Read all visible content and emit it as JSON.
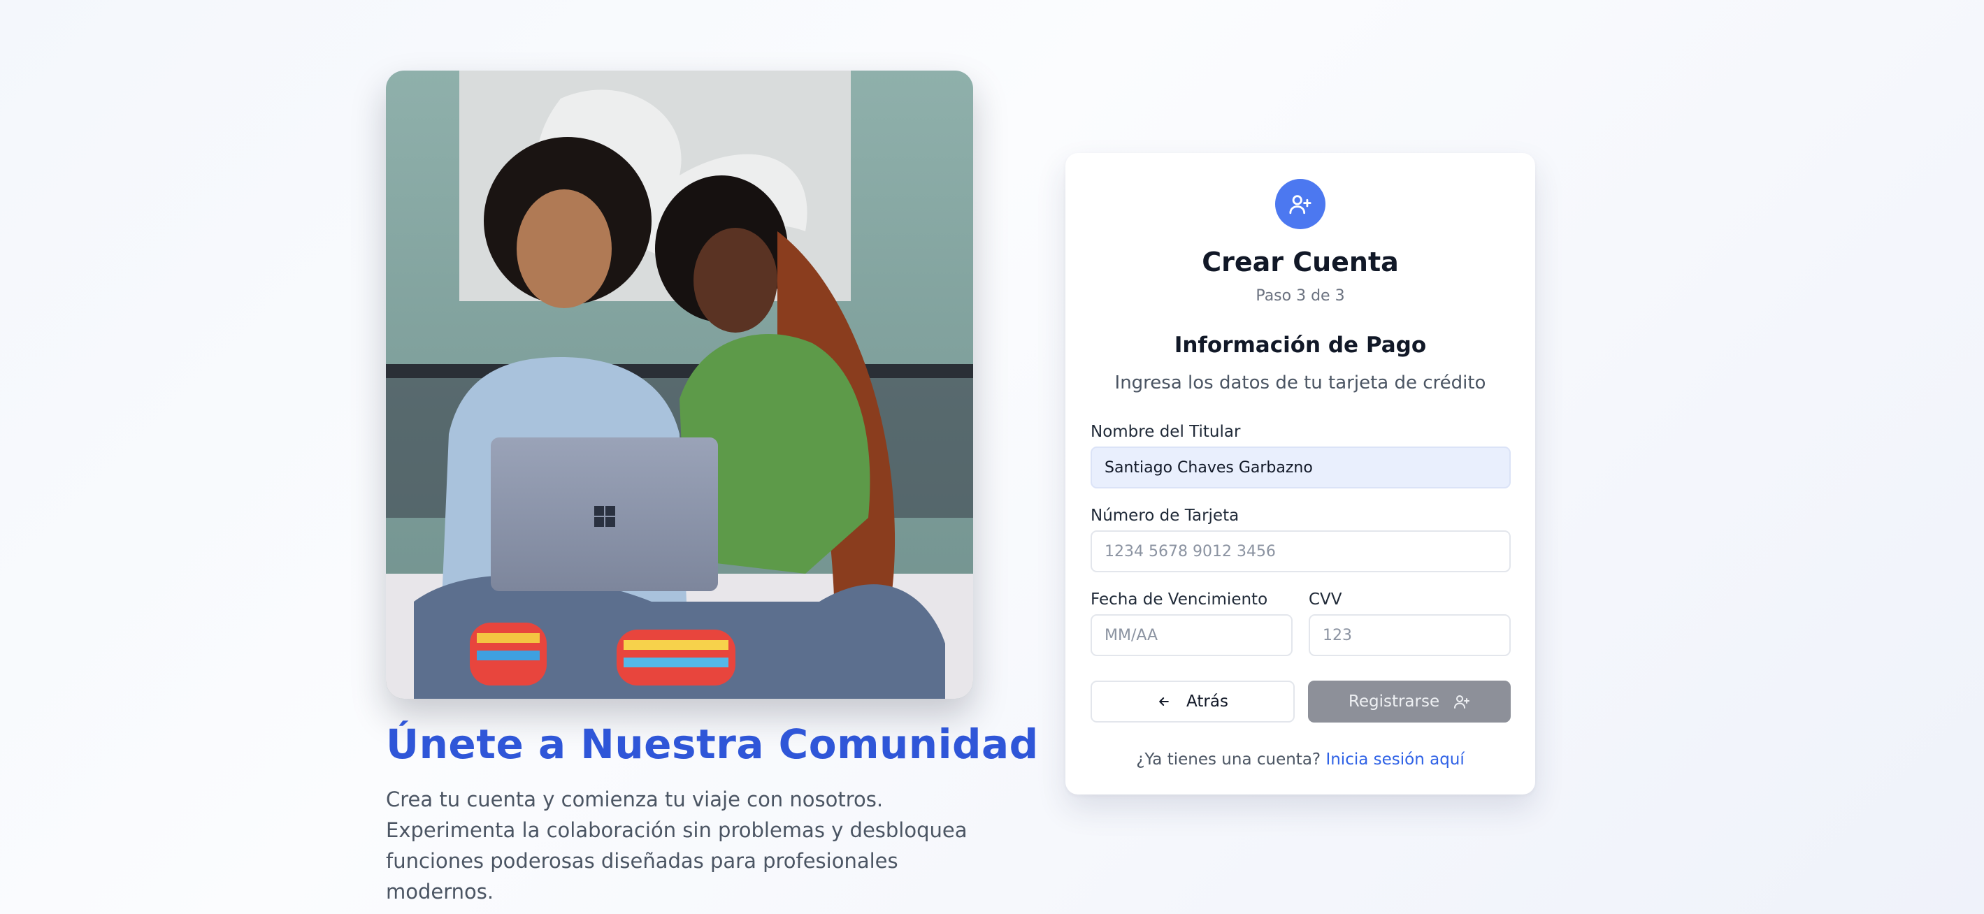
{
  "hero": {
    "photo": "two-women-laptop-photo",
    "title": "Únete a Nuestra Comunidad",
    "description": "Crea tu cuenta y comienza tu viaje con nosotros. Experimenta la colaboración sin problemas y desbloquea funciones poderosas diseñadas para profesionales modernos."
  },
  "card": {
    "icon": "user-plus-icon",
    "title": "Crear Cuenta",
    "step": "Paso 3 de 3",
    "section_title": "Información de Pago",
    "section_subtitle": "Ingresa los datos de tu tarjeta de crédito",
    "fields": {
      "holder": {
        "label": "Nombre del Titular",
        "value": "Santiago Chaves Garbazno",
        "placeholder": ""
      },
      "card_number": {
        "label": "Número de Tarjeta",
        "value": "",
        "placeholder": "1234 5678 9012 3456"
      },
      "expiry": {
        "label": "Fecha de Vencimiento",
        "value": "",
        "placeholder": "MM/AA"
      },
      "cvv": {
        "label": "CVV",
        "value": "",
        "placeholder": "123"
      }
    },
    "buttons": {
      "back": {
        "label": "Atrás",
        "icon": "arrow-left-icon"
      },
      "register": {
        "label": "Registrarse",
        "icon": "user-plus-icon"
      }
    },
    "login_prompt": "¿Ya tienes una cuenta?",
    "login_link": "Inicia sesión aquí"
  },
  "colors": {
    "accent": "#2f56d8",
    "badge": "#4c78f0",
    "link": "#2f62e6",
    "register_disabled": "#8d9099",
    "filled_input": "#e9effd"
  }
}
